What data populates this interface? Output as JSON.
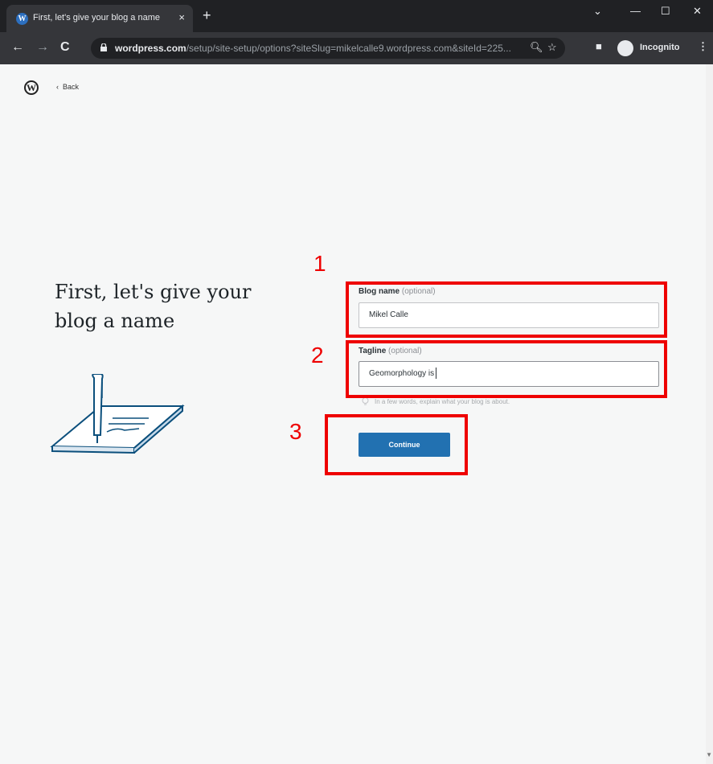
{
  "browser": {
    "tab_title": "First, let's give your blog a name",
    "tab_favicon": "wordpress-icon",
    "tab_close": "×",
    "new_tab": "+",
    "window_controls": [
      "⌄",
      "—",
      "☐",
      "✕"
    ],
    "url_host": "wordpress.com",
    "url_path": "/setup/site-setup/options?siteSlug=mikelcalle9.wordpress.com&siteId=225...",
    "profile_label": "Incognito"
  },
  "page": {
    "back_label": "Back",
    "headline": "First, let's give your blog a name",
    "blog_name": {
      "label": "Blog name",
      "optional": "(optional)",
      "value": "Mikel Calle"
    },
    "tagline": {
      "label": "Tagline",
      "optional": "(optional)",
      "value": "Geomorphology is"
    },
    "helper_text": "In a few words, explain what your blog is about.",
    "continue_label": "Continue"
  },
  "annotations": [
    {
      "number": "1"
    },
    {
      "number": "2"
    },
    {
      "number": "3"
    }
  ],
  "colors": {
    "annotation": "#ee0000",
    "primary_button": "#2271b1",
    "page_background": "#f6f7f7"
  }
}
